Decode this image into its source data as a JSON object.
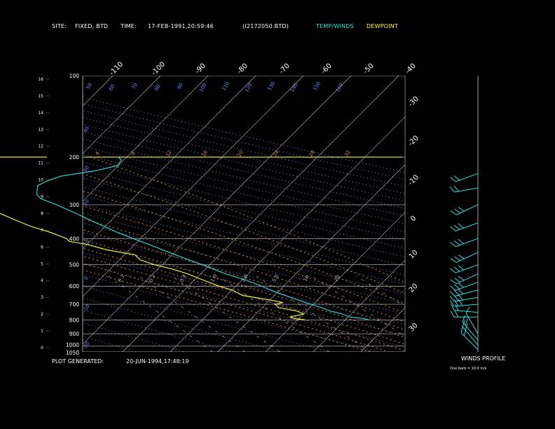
{
  "header": {
    "site_label": "SITE:",
    "site_value": "FIXED, BTD",
    "time_label": "TIME:",
    "time_value": "17-FEB-1991,20:59:46",
    "file_value": "(I2172050.BTD)",
    "legend_temp": "TEMP/WINDS",
    "legend_dew": "DEWPOINT"
  },
  "footer": {
    "generated_label": "PLOT GENERATED:",
    "generated_value": "20-JUN-1994,17:48:19",
    "winds_title": "WINDS PROFILE",
    "barb_note": "One barb = 10.0 m/s"
  },
  "colors": {
    "temperature": "#33e0e0",
    "dewpoint": "#ffff40",
    "isobar": "#c8c8c8",
    "isotherm": "#c8c8c8",
    "dry_adiabat": "#6a8cff",
    "moist_adiabat": "#e08a50",
    "mixing_ratio": "#9a9a9a",
    "wind": "#33e0e0"
  },
  "chart_data": {
    "type": "line",
    "title": "",
    "pressure_levels": [
      100,
      200,
      300,
      400,
      500,
      600,
      700,
      800,
      900,
      1000,
      1050
    ],
    "height_km_ticks": [
      0,
      1,
      2,
      3,
      4,
      5,
      6,
      7,
      8,
      9,
      10,
      11,
      12,
      13,
      14,
      15,
      16
    ],
    "isotherm_top_labels": [
      "-110",
      "-100",
      "-90",
      "-80",
      "-70",
      "-60",
      "-50",
      "-40"
    ],
    "isotherm_right_labels": [
      "-30",
      "-20",
      "-10",
      "0",
      "10",
      "20",
      "30"
    ],
    "dry_adiabat_labels": [
      "50",
      "60",
      "70",
      "80",
      "90",
      "100",
      "110",
      "120",
      "130",
      "140",
      "150",
      "160"
    ],
    "dry_adiabat_left_labels": [
      "40",
      "30",
      "20",
      "10",
      "0",
      "-10",
      "-20",
      "-30"
    ],
    "moist_adiabat_labels": [
      "4",
      "8",
      "12",
      "16",
      "20",
      "24",
      "28",
      "32"
    ],
    "mixing_ratio_labels": [
      "0.1",
      "0.2",
      "0.4",
      "1.0",
      "2.0",
      "5.0",
      "10",
      "20"
    ],
    "series": [
      {
        "name": "TEMP/WINDS",
        "points": [
          [
            800,
            -1.5
          ],
          [
            790,
            -2.5
          ],
          [
            780,
            -5
          ],
          [
            760,
            -6
          ],
          [
            740,
            -8
          ],
          [
            720,
            -9
          ],
          [
            700,
            -10.5
          ],
          [
            680,
            -12
          ],
          [
            650,
            -14
          ],
          [
            620,
            -16
          ],
          [
            600,
            -17
          ],
          [
            570,
            -19
          ],
          [
            540,
            -22
          ],
          [
            520,
            -23.5
          ],
          [
            500,
            -25
          ],
          [
            460,
            -28.5
          ],
          [
            420,
            -32
          ],
          [
            400,
            -34
          ],
          [
            380,
            -36
          ],
          [
            350,
            -38.5
          ],
          [
            320,
            -41
          ],
          [
            300,
            -43
          ],
          [
            285,
            -45
          ],
          [
            275,
            -45
          ],
          [
            265,
            -44
          ],
          [
            255,
            -43
          ],
          [
            245,
            -40
          ],
          [
            235,
            -36
          ],
          [
            225,
            -28
          ],
          [
            215,
            -22
          ],
          [
            205,
            -20
          ],
          [
            200,
            -20
          ]
        ]
      },
      {
        "name": "DEWPOINT",
        "points": [
          [
            800,
            -15
          ],
          [
            790,
            -17
          ],
          [
            780,
            -17.5
          ],
          [
            760,
            -14
          ],
          [
            740,
            -15
          ],
          [
            720,
            -18
          ],
          [
            700,
            -18
          ],
          [
            690,
            -16
          ],
          [
            670,
            -19
          ],
          [
            650,
            -23
          ],
          [
            620,
            -24
          ],
          [
            600,
            -26
          ],
          [
            570,
            -28
          ],
          [
            540,
            -30
          ],
          [
            520,
            -32
          ],
          [
            500,
            -35
          ],
          [
            480,
            -37
          ],
          [
            460,
            -37
          ],
          [
            440,
            -42
          ],
          [
            420,
            -45
          ],
          [
            410,
            -48
          ],
          [
            400,
            -48
          ],
          [
            380,
            -50
          ],
          [
            360,
            -53
          ],
          [
            340,
            -55
          ],
          [
            320,
            -57
          ],
          [
            300,
            -60
          ],
          [
            280,
            -64
          ],
          [
            260,
            -66
          ],
          [
            250,
            -65
          ],
          [
            240,
            -68
          ],
          [
            230,
            -72
          ],
          [
            220,
            -75
          ],
          [
            210,
            -78
          ],
          [
            205,
            -80
          ],
          [
            200,
            -82
          ],
          [
            200,
            -35
          ]
        ]
      }
    ],
    "winds": [
      {
        "p": 1030,
        "speed": 22,
        "dir": 315
      },
      {
        "p": 990,
        "speed": 20,
        "dir": 320
      },
      {
        "p": 950,
        "speed": 18,
        "dir": 320
      },
      {
        "p": 900,
        "speed": 12,
        "dir": 330
      },
      {
        "p": 780,
        "speed": 20,
        "dir": 270
      },
      {
        "p": 750,
        "speed": 22,
        "dir": 275
      },
      {
        "p": 700,
        "speed": 25,
        "dir": 265
      },
      {
        "p": 660,
        "speed": 30,
        "dir": 260
      },
      {
        "p": 620,
        "speed": 28,
        "dir": 255
      },
      {
        "p": 580,
        "speed": 30,
        "dir": 250
      },
      {
        "p": 540,
        "speed": 33,
        "dir": 245
      },
      {
        "p": 500,
        "speed": 30,
        "dir": 250
      },
      {
        "p": 450,
        "speed": 28,
        "dir": 245
      },
      {
        "p": 400,
        "speed": 32,
        "dir": 250
      },
      {
        "p": 350,
        "speed": 28,
        "dir": 250
      },
      {
        "p": 300,
        "speed": 25,
        "dir": 245
      },
      {
        "p": 260,
        "speed": 20,
        "dir": 260
      },
      {
        "p": 230,
        "speed": 18,
        "dir": 250
      }
    ]
  }
}
